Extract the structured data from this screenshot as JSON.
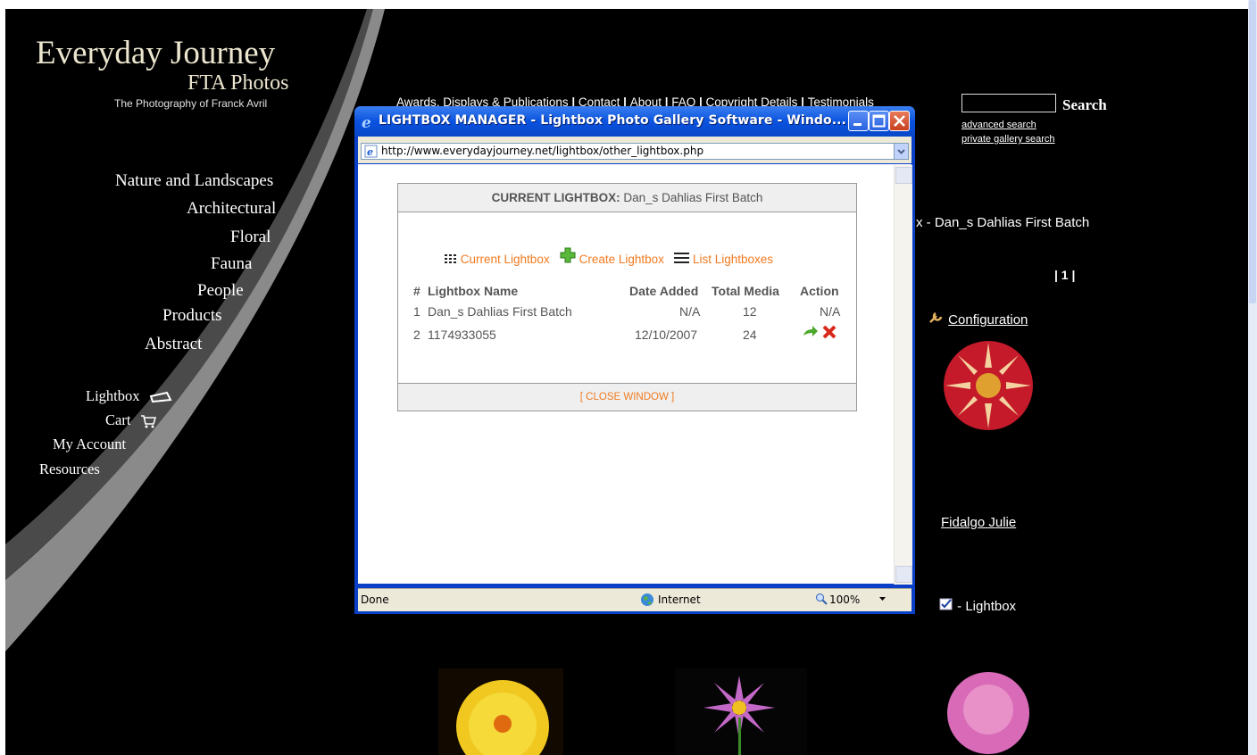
{
  "site": {
    "title": "Everyday Journey",
    "subtitle": "FTA Photos",
    "tagline": "The Photography of Franck Avril"
  },
  "topnav": {
    "items": [
      "Awards, Displays & Publications",
      "Contact",
      "About",
      "FAQ",
      "Copyright Details",
      "Testimonials"
    ],
    "separator": " | "
  },
  "search": {
    "button_label": "Search",
    "advanced": "advanced search",
    "private": "private gallery search"
  },
  "categories": [
    "Nature and Landscapes",
    "Architectural",
    "Floral",
    "Fauna",
    "People",
    "Products",
    "Abstract"
  ],
  "side_links": {
    "lightbox": "Lightbox",
    "cart": "Cart",
    "account": "My Account",
    "resources": "Resources"
  },
  "right_panel": {
    "lightbox_title_fragment": "x - Dan_s Dahlias First Batch",
    "pagination": "| 1 |",
    "configuration": "Configuration",
    "photo_name": "Fidalgo Julie",
    "lightbox_check": "- Lightbox"
  },
  "popup": {
    "title": "LIGHTBOX MANAGER - Lightbox Photo Gallery Software - Windo...",
    "url": "http://www.everydayjourney.net/lightbox/other_lightbox.php",
    "status_done": "Done",
    "status_zone": "Internet",
    "zoom": "100%",
    "current_label": "CURRENT LIGHTBOX:",
    "current_value": "Dan_s Dahlias First Batch",
    "link_current": "Current Lightbox",
    "link_create": "Create Lightbox",
    "link_list": "List Lightboxes",
    "columns": [
      "#",
      "Lightbox Name",
      "Date Added",
      "Total Media",
      "Action"
    ],
    "rows": [
      {
        "num": "1",
        "name": "Dan_s Dahlias First Batch",
        "date": "N/A",
        "total": "12",
        "action": "N/A"
      },
      {
        "num": "2",
        "name": "1174933055",
        "date": "12/10/2007",
        "total": "24",
        "action": ""
      }
    ],
    "close": "[ CLOSE WINDOW ]"
  },
  "colors": {
    "accent_orange": "#f07a20",
    "page_bg": "#000000",
    "xp_blue": "#0a52df"
  }
}
